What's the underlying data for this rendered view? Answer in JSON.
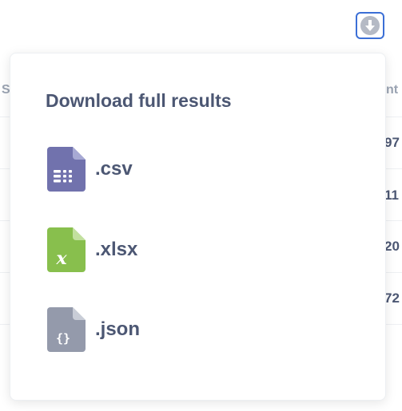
{
  "background": {
    "header_left": "S",
    "header_right": "nt",
    "cells": [
      "97",
      "11",
      "20",
      "72"
    ]
  },
  "toolbar": {
    "download_icon": "download-circle-icon"
  },
  "popover": {
    "title": "Download full results",
    "options": [
      {
        "label": ".csv",
        "icon": "csv-file-icon",
        "color": "#7172ad"
      },
      {
        "label": ".xlsx",
        "icon": "xlsx-file-icon",
        "color": "#88bf4d"
      },
      {
        "label": ".json",
        "icon": "json-file-icon",
        "color": "#949aab"
      }
    ]
  },
  "colors": {
    "accent": "#3b6fd6",
    "text": "#4c5773"
  }
}
